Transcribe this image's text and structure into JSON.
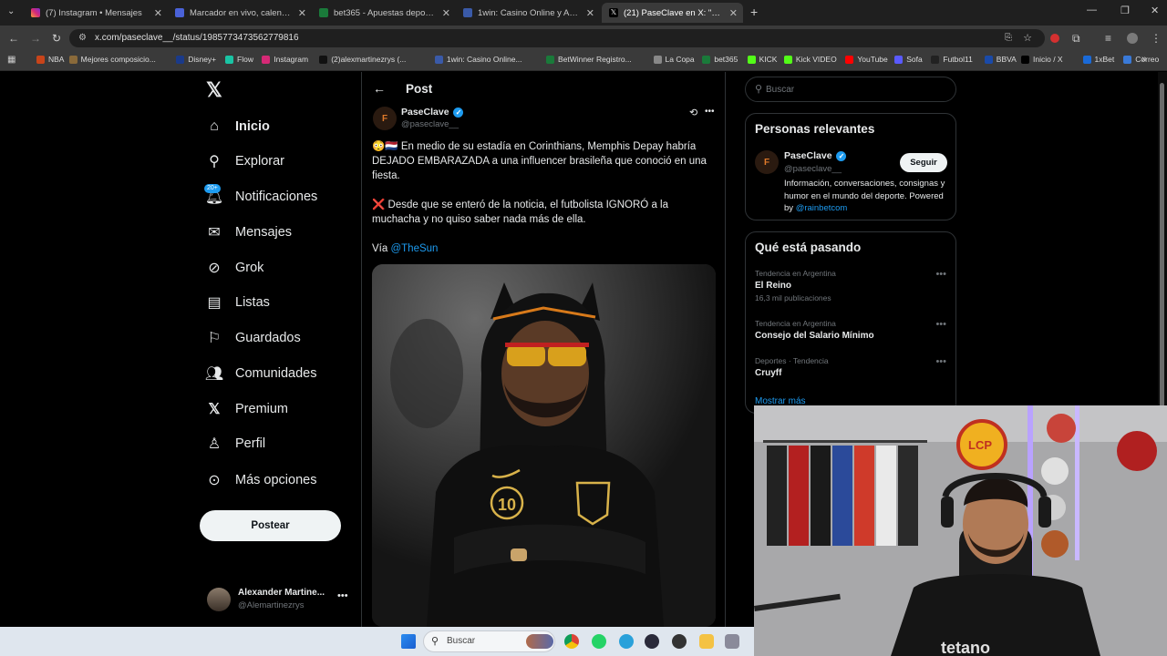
{
  "browser": {
    "tabs": [
      {
        "label": "(7) Instagram • Mensajes",
        "active": false
      },
      {
        "label": "Marcador en vivo, calendario y",
        "active": false
      },
      {
        "label": "bet365 - Apuestas deportivas e",
        "active": false
      },
      {
        "label": "1win: Casino Online y Apuestas",
        "active": false
      },
      {
        "label": "(21) PaseClave en X: \"😳🇳🇱 En m",
        "active": true
      }
    ],
    "url": "x.com/paseclave__/status/1985773473562779816",
    "bookmarks": [
      "NBA",
      "Mejores composicio...",
      "Disney+",
      "Flow",
      "Instagram",
      "(2)alexmartinezrys (...",
      "1win: Casino Online...",
      "BetWinner Registro...",
      "La Copa",
      "bet365",
      "KICK",
      "Kick VIDEO",
      "YouTube",
      "Sofa",
      "Futbol11",
      "BBVA",
      "Inicio / X",
      "1xBet",
      "Correo"
    ]
  },
  "sidebar": {
    "items": [
      {
        "label": "Inicio",
        "icon": "home-icon"
      },
      {
        "label": "Explorar",
        "icon": "search-icon"
      },
      {
        "label": "Notificaciones",
        "icon": "bell-icon",
        "badge": "20+"
      },
      {
        "label": "Mensajes",
        "icon": "mail-icon"
      },
      {
        "label": "Grok",
        "icon": "grok-icon"
      },
      {
        "label": "Listas",
        "icon": "list-icon"
      },
      {
        "label": "Guardados",
        "icon": "bookmark-icon"
      },
      {
        "label": "Comunidades",
        "icon": "people-icon"
      },
      {
        "label": "Premium",
        "icon": "x-logo-icon"
      },
      {
        "label": "Perfil",
        "icon": "person-icon"
      },
      {
        "label": "Más opciones",
        "icon": "more-circle-icon"
      }
    ],
    "post_button": "Postear",
    "account": {
      "name": "Alexander Martine...",
      "handle": "@Alemartinezrys"
    }
  },
  "post": {
    "header": "Post",
    "author": {
      "name": "PaseClave",
      "handle": "@paseclave__"
    },
    "paragraph1": "😳🇳🇱 En medio de su estadía en Corinthians, Memphis Depay habría DEJADO EMBARAZADA a una influencer brasileña que conoció en una fiesta.",
    "paragraph2": "❌ Desde que se enteró de la noticia, el futbolista IGNORÓ a la muchacha y no quiso saber nada más de ella.",
    "via_prefix": "Vía ",
    "via_link": "@TheSun"
  },
  "right": {
    "search_placeholder": "Buscar",
    "relevant": {
      "title": "Personas relevantes",
      "name": "PaseClave",
      "handle": "@paseclave__",
      "follow": "Seguir",
      "bio": "Información, conversaciones, consignas y humor en el mundo del deporte. Powered by ",
      "bio_link": "@rainbetcom"
    },
    "trends": {
      "title": "Qué está pasando",
      "items": [
        {
          "context": "Tendencia en Argentina",
          "name": "El Reino",
          "count": "16,3 mil publicaciones"
        },
        {
          "context": "Tendencia en Argentina",
          "name": "Consejo del Salario Mínimo",
          "count": ""
        },
        {
          "context": "Deportes · Tendencia",
          "name": "Cruyff",
          "count": ""
        }
      ],
      "show_more": "Mostrar más"
    }
  },
  "webcam": {
    "logo_text": "LCP",
    "shirt_text": "tetano"
  },
  "taskbar": {
    "search_placeholder": "Buscar"
  },
  "colors": {
    "accent": "#1d9bf0",
    "background": "#000000",
    "muted": "#71767b"
  }
}
